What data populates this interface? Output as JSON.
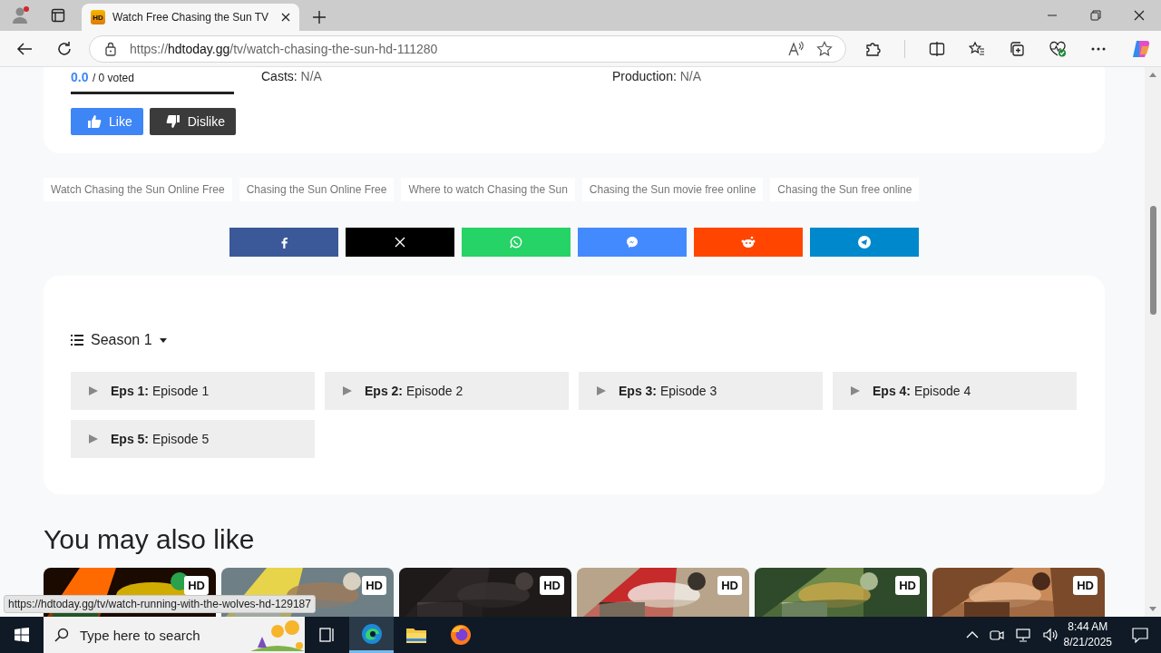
{
  "browser": {
    "tabs": [
      {
        "title": "Watch Free Chasing the Sun TV",
        "favicon": "HD",
        "selected": true
      }
    ],
    "url_host": "hdtoday.gg",
    "url_scheme": "https://",
    "url_path": "/tv/watch-chasing-the-sun-hd-111280",
    "status_url": "https://hdtoday.gg/tv/watch-running-with-the-wolves-hd-129187"
  },
  "rating": {
    "score": "0.0",
    "votes": "/ 0 voted"
  },
  "info": [
    {
      "label": "Casts:",
      "value": "N/A"
    },
    {
      "label": "Production:",
      "value": "N/A"
    }
  ],
  "vote_buttons": [
    {
      "kind": "like",
      "label": "Like"
    },
    {
      "kind": "dislike",
      "label": "Dislike"
    }
  ],
  "tags": [
    "Watch Chasing the Sun Online Free",
    "Chasing the Sun Online Free",
    "Where to watch Chasing the Sun",
    "Chasing the Sun movie free online",
    "Chasing the Sun free online"
  ],
  "share": [
    {
      "kind": "facebook",
      "color": "#3b5998"
    },
    {
      "kind": "x",
      "color": "#000000"
    },
    {
      "kind": "whatsapp",
      "color": "#25d366"
    },
    {
      "kind": "messenger",
      "color": "#448aff"
    },
    {
      "kind": "reddit",
      "color": "#ff4500"
    },
    {
      "kind": "telegram",
      "color": "#0088cc"
    }
  ],
  "season": {
    "label": "Season 1"
  },
  "episodes": [
    {
      "number": "Eps 1:",
      "title": "Episode 1"
    },
    {
      "number": "Eps 2:",
      "title": "Episode 2"
    },
    {
      "number": "Eps 3:",
      "title": "Episode 3"
    },
    {
      "number": "Eps 4:",
      "title": "Episode 4"
    },
    {
      "number": "Eps 5:",
      "title": "Episode 5"
    }
  ],
  "related": {
    "heading": "You may also like",
    "items": [
      {
        "kind": "picture",
        "badge": "HD"
      },
      {
        "kind": "picture",
        "badge": "HD"
      },
      {
        "kind": "picture",
        "badge": "HD"
      },
      {
        "kind": "picture",
        "badge": "HD"
      },
      {
        "kind": "picture",
        "badge": "HD"
      },
      {
        "kind": "picture",
        "badge": "HD"
      }
    ]
  },
  "taskbar": {
    "search_placeholder": "Type here to search",
    "time": "8:44 AM",
    "date": "8/21/2025"
  }
}
